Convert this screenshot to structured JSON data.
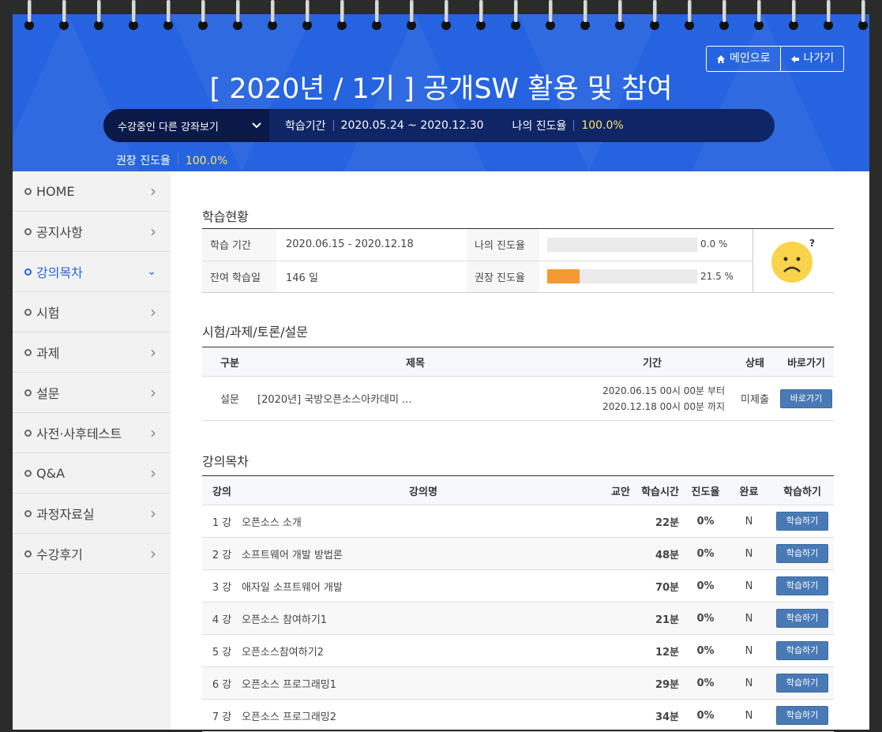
{
  "header": {
    "title": "[ 2020년 / 1기 ] 공개SW 활용 및 참여",
    "main_button": "메인으로",
    "exit_button": "나가기",
    "course_select": "수강중인 다른 강좌보기",
    "period_label": "학습기간",
    "period_value": "2020.05.24 ~ 2020.12.30",
    "my_progress_label": "나의 진도율",
    "my_progress_value": "100.0%",
    "recommended_label": "권장 진도율",
    "recommended_value": "100.0%"
  },
  "sidebar": {
    "items": [
      {
        "label": "HOME"
      },
      {
        "label": "공지사항"
      },
      {
        "label": "강의목차"
      },
      {
        "label": "시험"
      },
      {
        "label": "과제"
      },
      {
        "label": "설문"
      },
      {
        "label": "사전·사후테스트"
      },
      {
        "label": "Q&A"
      },
      {
        "label": "과정자료실"
      },
      {
        "label": "수강후기"
      }
    ],
    "active_index": 2
  },
  "status": {
    "title": "학습현황",
    "period_label": "학습 기간",
    "period_value": "2020.06.15 - 2020.12.18",
    "remaining_label": "잔여 학습일",
    "remaining_value": "146 일",
    "my_label": "나의 진도율",
    "my_pct": "0.0 %",
    "my_fraction": 0.0,
    "rec_label": "권장 진도율",
    "rec_pct": "21.5 %",
    "rec_fraction": 0.215,
    "face_mark": "?"
  },
  "tasks": {
    "title": "시험/과제/토론/설문",
    "headers": [
      "구분",
      "제목",
      "기간",
      "상태",
      "바로가기"
    ],
    "rows": [
      {
        "type": "설문",
        "title": "[2020년] 국방오픈소스아카데미 ...",
        "from": "2020.06.15 00시 00분 부터",
        "to": "2020.12.18 00시 00분 까지",
        "status": "미제출",
        "button": "바로가기"
      }
    ]
  },
  "lectures": {
    "title": "강의목차",
    "headers": [
      "강의",
      "강의명",
      "교안",
      "학습시간",
      "진도율",
      "완료",
      "학습하기"
    ],
    "button": "학습하기",
    "rows": [
      {
        "no": "1 강",
        "name": "오픈소스 소개",
        "time": "22분",
        "progress": "0%",
        "done": "N"
      },
      {
        "no": "2 강",
        "name": "소프트웨어 개발 방법론",
        "time": "48분",
        "progress": "0%",
        "done": "N"
      },
      {
        "no": "3 강",
        "name": "애자일 소프트웨어 개발",
        "time": "70분",
        "progress": "0%",
        "done": "N"
      },
      {
        "no": "4 강",
        "name": "오픈소스 참여하기1",
        "time": "21분",
        "progress": "0%",
        "done": "N"
      },
      {
        "no": "5 강",
        "name": "오픈소스참여하기2",
        "time": "12분",
        "progress": "0%",
        "done": "N"
      },
      {
        "no": "6 강",
        "name": "오픈소스 프로그래밍1",
        "time": "29분",
        "progress": "0%",
        "done": "N"
      },
      {
        "no": "7 강",
        "name": "오픈소스 프로그래밍2",
        "time": "34분",
        "progress": "0%",
        "done": "N"
      }
    ]
  },
  "colors": {
    "brand": "#2563e0",
    "navy": "#0f2565",
    "accent": "#f59a33",
    "highlight": "#ffe85c",
    "button": "#4a7ab5"
  }
}
